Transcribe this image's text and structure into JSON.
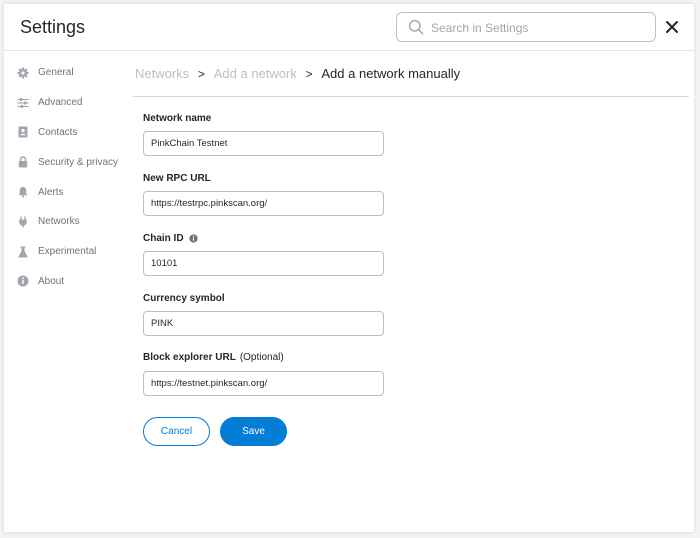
{
  "header": {
    "title": "Settings",
    "search_placeholder": "Search in Settings",
    "close_icon": "close-icon"
  },
  "sidebar": {
    "items": [
      {
        "label": "General",
        "icon": "gear-icon"
      },
      {
        "label": "Advanced",
        "icon": "sliders-icon"
      },
      {
        "label": "Contacts",
        "icon": "contact-book-icon"
      },
      {
        "label": "Security & privacy",
        "icon": "lock-icon"
      },
      {
        "label": "Alerts",
        "icon": "bell-icon"
      },
      {
        "label": "Networks",
        "icon": "plug-icon"
      },
      {
        "label": "Experimental",
        "icon": "flask-icon"
      },
      {
        "label": "About",
        "icon": "info-icon"
      }
    ]
  },
  "breadcrumb": {
    "items": [
      "Networks",
      "Add a network"
    ],
    "separator": ">",
    "current": "Add a network manually"
  },
  "form": {
    "network_name": {
      "label": "Network name",
      "value": "PinkChain Testnet"
    },
    "rpc_url": {
      "label": "New RPC URL",
      "value": "https://testrpc.pinkscan.org/"
    },
    "chain_id": {
      "label": "Chain ID",
      "value": "10101",
      "info_icon": "info-icon"
    },
    "currency_symbol": {
      "label": "Currency symbol",
      "value": "PINK"
    },
    "explorer_url": {
      "label": "Block explorer URL",
      "optional_label": "(Optional)",
      "value": "https://testnet.pinkscan.org/"
    }
  },
  "buttons": {
    "cancel_label": "Cancel",
    "save_label": "Save"
  },
  "colors": {
    "accent": "#037dd6",
    "muted_text": "#6a737d",
    "breadcrumb_inactive": "#bbc0c5"
  }
}
